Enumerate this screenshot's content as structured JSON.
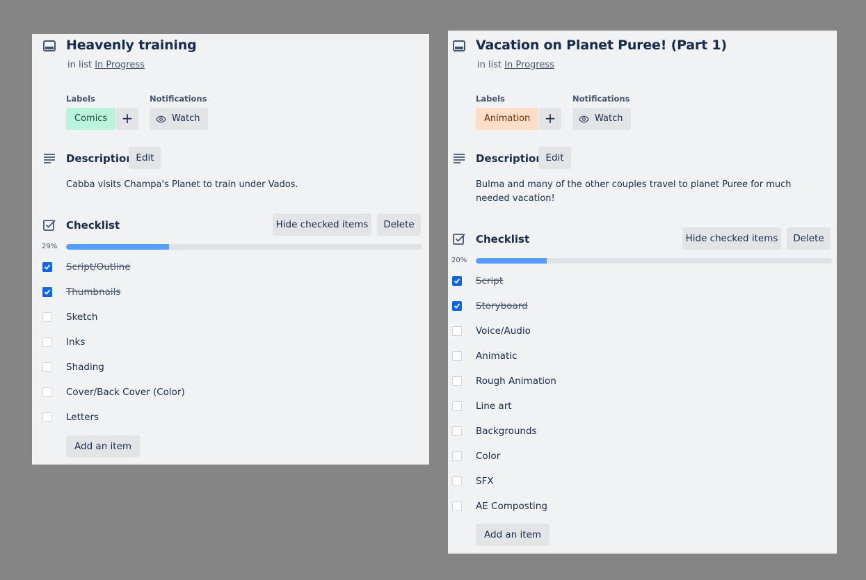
{
  "cards": [
    {
      "title": "Heavenly training",
      "in_list_prefix": "in list",
      "list_name": "In Progress",
      "labels_heading": "Labels",
      "notifications_heading": "Notifications",
      "label": {
        "text": "Comics",
        "bg": "#baf3db",
        "fg": "#164b35"
      },
      "watch_label": "Watch",
      "description_heading": "Description",
      "edit_label": "Edit",
      "description": "Cabba visits Champa's Planet to train under Vados.",
      "checklist_heading": "Checklist",
      "hide_checked_label": "Hide checked items",
      "delete_label": "Delete",
      "progress_text": "29%",
      "progress": 0.29,
      "items": [
        {
          "text": "Script/Outline",
          "checked": true
        },
        {
          "text": "Thumbnails",
          "checked": true
        },
        {
          "text": "Sketch",
          "checked": false
        },
        {
          "text": "Inks",
          "checked": false
        },
        {
          "text": "Shading",
          "checked": false
        },
        {
          "text": "Cover/Back Cover (Color)",
          "checked": false
        },
        {
          "text": "Letters",
          "checked": false
        }
      ],
      "add_item_label": "Add an item"
    },
    {
      "title": "Vacation on Planet Puree! (Part 1)",
      "in_list_prefix": "in list",
      "list_name": "In Progress",
      "labels_heading": "Labels",
      "notifications_heading": "Notifications",
      "label": {
        "text": "Animation",
        "bg": "#fedec8",
        "fg": "#702e00"
      },
      "watch_label": "Watch",
      "description_heading": "Description",
      "edit_label": "Edit",
      "description": "Bulma and many of the other couples travel to planet Puree for much needed vacation!",
      "checklist_heading": "Checklist",
      "hide_checked_label": "Hide checked items",
      "delete_label": "Delete",
      "progress_text": "20%",
      "progress": 0.2,
      "items": [
        {
          "text": "Script",
          "checked": true
        },
        {
          "text": "Storyboard",
          "checked": true
        },
        {
          "text": "Voice/Audio",
          "checked": false
        },
        {
          "text": "Animatic",
          "checked": false
        },
        {
          "text": "Rough Animation",
          "checked": false
        },
        {
          "text": "Line art",
          "checked": false
        },
        {
          "text": "Backgrounds",
          "checked": false
        },
        {
          "text": "Color",
          "checked": false
        },
        {
          "text": "SFX",
          "checked": false
        },
        {
          "text": "AE Composting",
          "checked": false
        }
      ],
      "add_item_label": "Add an item"
    }
  ],
  "icons": {
    "card": "card-icon",
    "description": "description-icon",
    "checklist": "checklist-icon",
    "watch": "eye-icon",
    "check": "checkmark-icon"
  },
  "colors": {
    "accent": "#0c66e4",
    "progress_fill": "#579dff",
    "panel": "#f1f2f4",
    "backdrop": "#858585"
  }
}
